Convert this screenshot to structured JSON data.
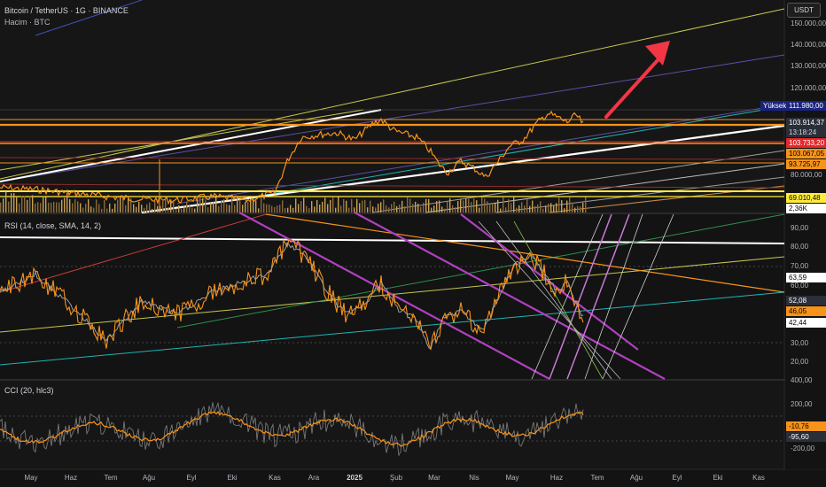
{
  "header": {
    "title": "Bitcoin / TetherUS · 1G · BINANCE",
    "volume_legend": "Hacim · BTC",
    "currency": "USDT"
  },
  "price_axis": {
    "ticks": [
      "150.000,00",
      "140.000,00",
      "130.000,00",
      "120.000,00",
      "80.000,00"
    ],
    "high_label": "Yüksek",
    "high_value": "111.980,00",
    "current_price": "103.914,37",
    "countdown": "13:18:24",
    "levels": [
      {
        "value": "103.733,20",
        "color": "#e5282a",
        "text_color": "#ffffff"
      },
      {
        "value": "103.067,05",
        "color": "#f7931a",
        "text_color": "#000000"
      },
      {
        "value": "93.725,97",
        "color": "#f7931a",
        "text_color": "#000000"
      },
      {
        "value": "69.010,48",
        "color": "#ffeb3b",
        "text_color": "#000000"
      }
    ],
    "volume_value": "2,36K"
  },
  "rsi": {
    "legend": "RSI (14, close, SMA, 14, 2)",
    "ticks": [
      "90,00",
      "80,00",
      "70,00",
      "60,00",
      "30,00",
      "20,00"
    ],
    "values": [
      {
        "value": "63,59",
        "color": "#ffffff",
        "text_color": "#000000"
      },
      {
        "value": "52,08",
        "color": "#2a2e39",
        "text_color": "#ffffff"
      },
      {
        "value": "46,05",
        "color": "#f7931a",
        "text_color": "#000000"
      },
      {
        "value": "42,44",
        "color": "#ffffff",
        "text_color": "#000000"
      }
    ]
  },
  "cci": {
    "legend": "CCI (20, hlc3)",
    "ticks": [
      "400,00",
      "200,00",
      "-200,00"
    ],
    "values": [
      {
        "value": "-10,76",
        "color": "#f7931a",
        "text_color": "#000000"
      },
      {
        "value": "-95,60",
        "color": "#2a2e39",
        "text_color": "#ffffff"
      }
    ]
  },
  "time_axis": {
    "months": [
      "May",
      "Haz",
      "Tem",
      "Ağu",
      "Eyl",
      "Eki",
      "Kas",
      "Ara",
      "2025",
      "Şub",
      "Mar",
      "Nis",
      "May",
      "Haz",
      "Tem",
      "Ağu",
      "Eyl",
      "Eki",
      "Kas"
    ]
  },
  "colors": {
    "background": "#131313",
    "candle": "#f7931a",
    "annotation_arrow": "#f23645",
    "rsi_line": "#f7931a",
    "rsi_ma": "#9e9e9e"
  }
}
